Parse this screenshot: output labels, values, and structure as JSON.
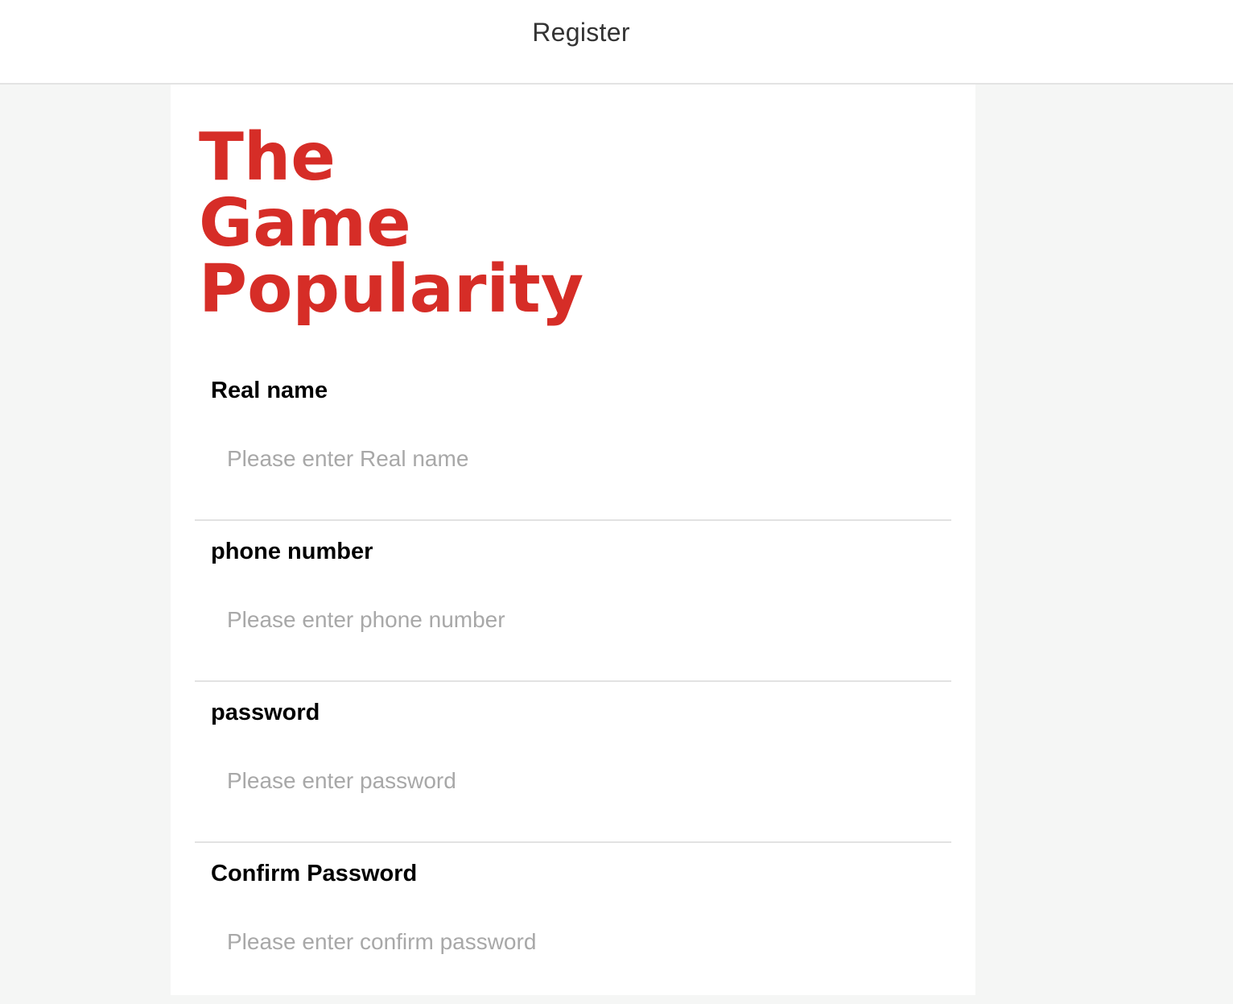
{
  "header": {
    "title": "Register"
  },
  "logo": {
    "line1": "The",
    "line2": "Game",
    "line3": "Popularity",
    "color": "#d62d27"
  },
  "form": {
    "fields": [
      {
        "label": "Real name",
        "placeholder": "Please enter Real name",
        "value": ""
      },
      {
        "label": "phone number",
        "placeholder": "Please enter phone number",
        "value": ""
      },
      {
        "label": "password",
        "placeholder": "Please enter password",
        "value": ""
      },
      {
        "label": "Confirm Password",
        "placeholder": "Please enter confirm password",
        "value": ""
      }
    ]
  }
}
